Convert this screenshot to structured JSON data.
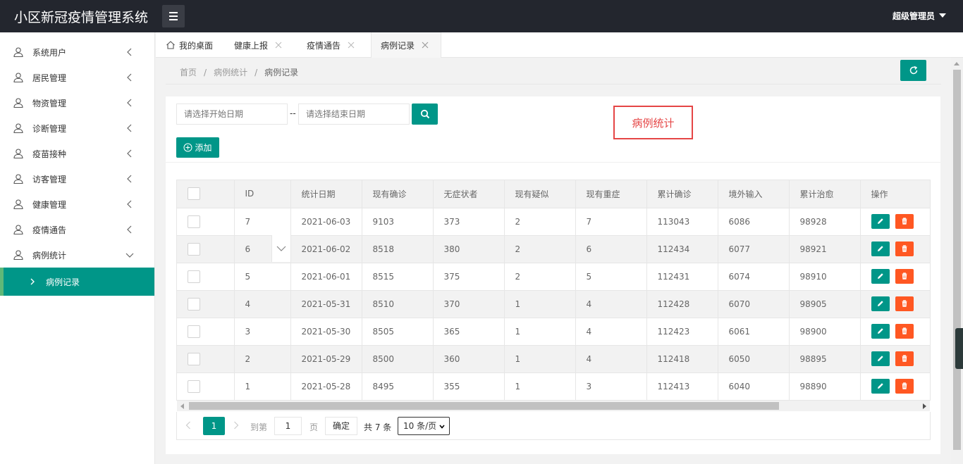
{
  "app": {
    "title": "小区新冠疫情管理系统",
    "user": "超级管理员"
  },
  "sidebar": {
    "items": [
      {
        "label": "系统用户"
      },
      {
        "label": "居民管理"
      },
      {
        "label": "物资管理"
      },
      {
        "label": "诊断管理"
      },
      {
        "label": "疫苗接种"
      },
      {
        "label": "访客管理"
      },
      {
        "label": "健康管理"
      },
      {
        "label": "疫情通告"
      },
      {
        "label": "病例统计"
      }
    ],
    "sub_item": "病例记录"
  },
  "tabs": [
    {
      "label": "我的桌面"
    },
    {
      "label": "健康上报"
    },
    {
      "label": "疫情通告"
    },
    {
      "label": "病例记录"
    }
  ],
  "breadcrumb": {
    "home": "首页",
    "parent": "病例统计",
    "current": "病例记录",
    "sep": "/"
  },
  "search": {
    "start_placeholder": "请选择开始日期",
    "end_placeholder": "请选择结束日期",
    "dash": "--"
  },
  "annotation": "病例统计",
  "add_label": "添加",
  "table": {
    "headers": [
      "ID",
      "统计日期",
      "现有确诊",
      "无症状者",
      "现有疑似",
      "现有重症",
      "累计确诊",
      "境外输入",
      "累计治愈",
      "操作"
    ],
    "rows": [
      [
        "7",
        "2021-06-03",
        "9103",
        "373",
        "2",
        "7",
        "113043",
        "6086",
        "98928"
      ],
      [
        "6",
        "2021-06-02",
        "8518",
        "380",
        "2",
        "6",
        "112434",
        "6077",
        "98921"
      ],
      [
        "5",
        "2021-06-01",
        "8515",
        "375",
        "2",
        "5",
        "112431",
        "6074",
        "98910"
      ],
      [
        "4",
        "2021-05-31",
        "8510",
        "370",
        "1",
        "4",
        "112428",
        "6070",
        "98905"
      ],
      [
        "3",
        "2021-05-30",
        "8505",
        "365",
        "1",
        "4",
        "112423",
        "6061",
        "98900"
      ],
      [
        "2",
        "2021-05-29",
        "8500",
        "360",
        "1",
        "4",
        "112418",
        "6050",
        "98895"
      ],
      [
        "1",
        "2021-05-28",
        "8495",
        "355",
        "1",
        "3",
        "112413",
        "6040",
        "98890"
      ]
    ]
  },
  "pager": {
    "current": "1",
    "goto_label": "到第",
    "page_value": "1",
    "page_unit": "页",
    "confirm": "确定",
    "total": "共 7 条",
    "page_size": "10 条/页"
  },
  "colors": {
    "primary": "#009688",
    "danger": "#ff5722",
    "topbar": "#23262e",
    "annotation": "#e54545"
  }
}
